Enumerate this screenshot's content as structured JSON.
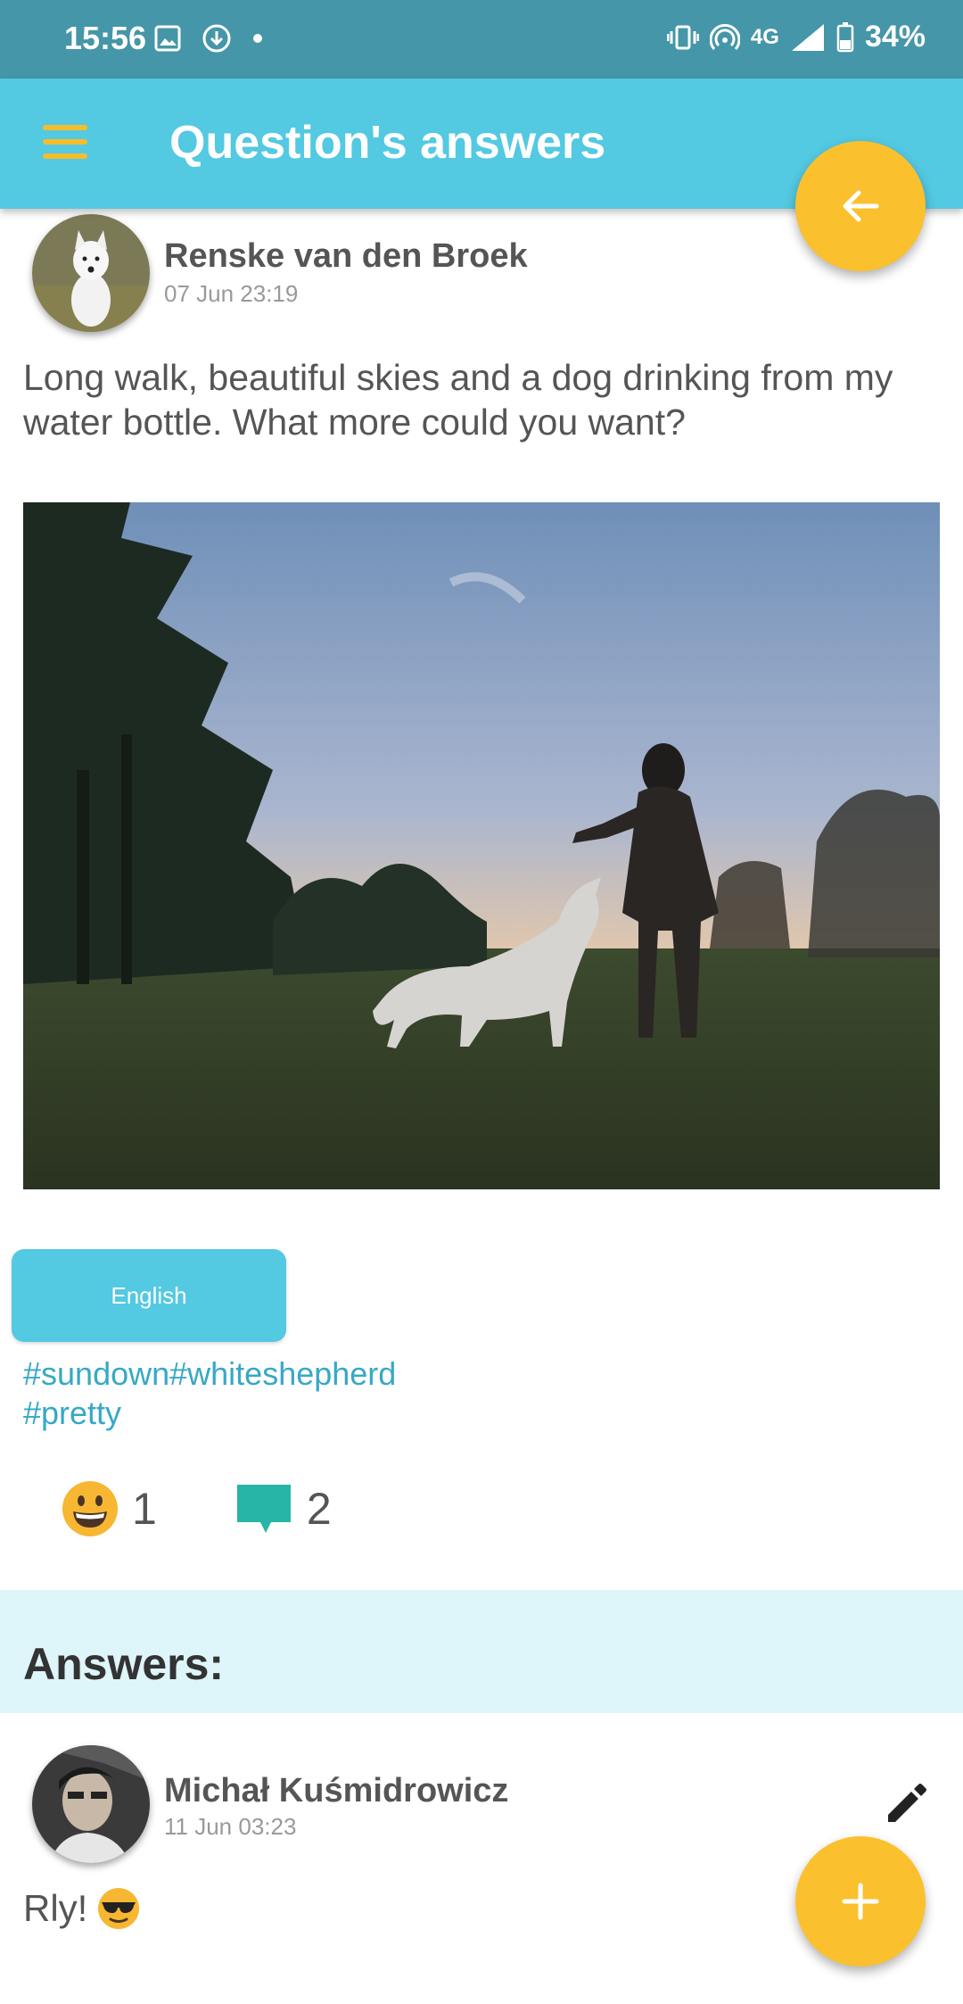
{
  "status_bar": {
    "time": "15:56",
    "network": "4G",
    "battery": "34%",
    "icons": [
      "image-icon",
      "download-icon",
      "dot-icon",
      "vibrate-icon",
      "hotspot-icon",
      "signal-icon",
      "battery-icon"
    ]
  },
  "app_bar": {
    "title": "Question's answers",
    "menu_icon": "menu-icon",
    "back_icon": "arrow-left-icon"
  },
  "post": {
    "author": "Renske van den Broek",
    "date": "07 Jun 23:19",
    "text": "Long walk, beautiful skies and a dog drinking from my water bottle. What more could you want?",
    "language_button": "English",
    "hashtags_line1": "#sundown#whiteshepherd",
    "hashtags_line2": "#pretty",
    "reaction_count": "1",
    "comment_count": "2"
  },
  "answers": {
    "title": "Answers:",
    "items": [
      {
        "author": "Michał Kuśmidrowicz",
        "date": "11 Jun 03:23",
        "text": "Rly!"
      }
    ]
  },
  "colors": {
    "status_bar": "#4596a8",
    "app_bar": "#53c9e2",
    "accent": "#fbc02d",
    "answers_band": "#def5f9",
    "hashtag": "#37a8c6",
    "comment_icon": "#26b5a6"
  }
}
